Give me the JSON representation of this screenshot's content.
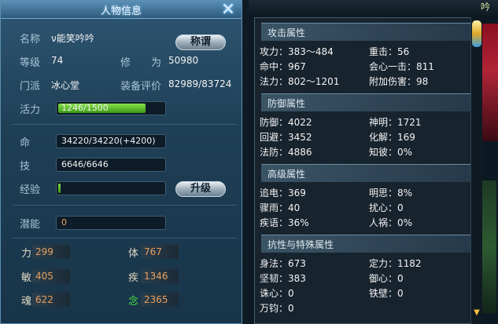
{
  "left_panel": {
    "title": "人物信息",
    "close_icon": "×",
    "name_label": "名称",
    "name_value": "ν能笑吟吟",
    "title_button": "称谓",
    "level_label": "等级",
    "level_value": "74",
    "cultivation_label": "修　　为",
    "cultivation_value": "50980",
    "sect_label": "门派",
    "sect_value": "冰心堂",
    "gear_score_label": "装备评价",
    "gear_score_value": "82989/83724",
    "vitality_label": "活力",
    "vitality_value": "1246/1500",
    "vitality_fraction": 0.83,
    "hp_label": "命",
    "hp_value": "34220/34220(+4200)",
    "skill_label": "技",
    "skill_value": "6646/6646",
    "exp_label": "经验",
    "exp_fraction": 0.02,
    "upgrade_button": "升级",
    "potential_label": "潜能",
    "potential_value": "0",
    "stats": [
      {
        "label": "力",
        "value": "299"
      },
      {
        "label": "体",
        "value": "767"
      },
      {
        "label": "敏",
        "value": "405"
      },
      {
        "label": "疾",
        "value": "1346"
      },
      {
        "label": "魂",
        "value": "622"
      },
      {
        "label": "念",
        "value": "2365"
      }
    ],
    "colors": {
      "stat_value": "#e8a060",
      "nian_label": "#44dd44",
      "bar_fill": "#5cc026"
    }
  },
  "right_panel": {
    "top_text": "吟",
    "sections": [
      {
        "title": "攻击属性",
        "rows": [
          [
            "攻力：383～484",
            "重击：56"
          ],
          [
            "命中：967",
            "会心一击：811"
          ],
          [
            "法力：802～1201",
            "附加伤害：98"
          ]
        ]
      },
      {
        "title": "防御属性",
        "rows": [
          [
            "防御：4022",
            "神明：1721"
          ],
          [
            "回避：3452",
            "化解：169"
          ],
          [
            "法防：4886",
            "知彼：0%"
          ]
        ]
      },
      {
        "title": "高级属性",
        "rows": [
          [
            "追电：369",
            "明思：8%"
          ],
          [
            "骤雨：40",
            "扰心：0"
          ],
          [
            "疾语：36%",
            "人祸：0%"
          ]
        ]
      },
      {
        "title": "抗性与特殊属性",
        "rows": [
          [
            "身法：673",
            "定力：1182"
          ],
          [
            "坚韧：383",
            "御心：0"
          ],
          [
            "诛心：0",
            "铁壁：0"
          ],
          [
            "万钧：0",
            ""
          ]
        ]
      }
    ]
  }
}
